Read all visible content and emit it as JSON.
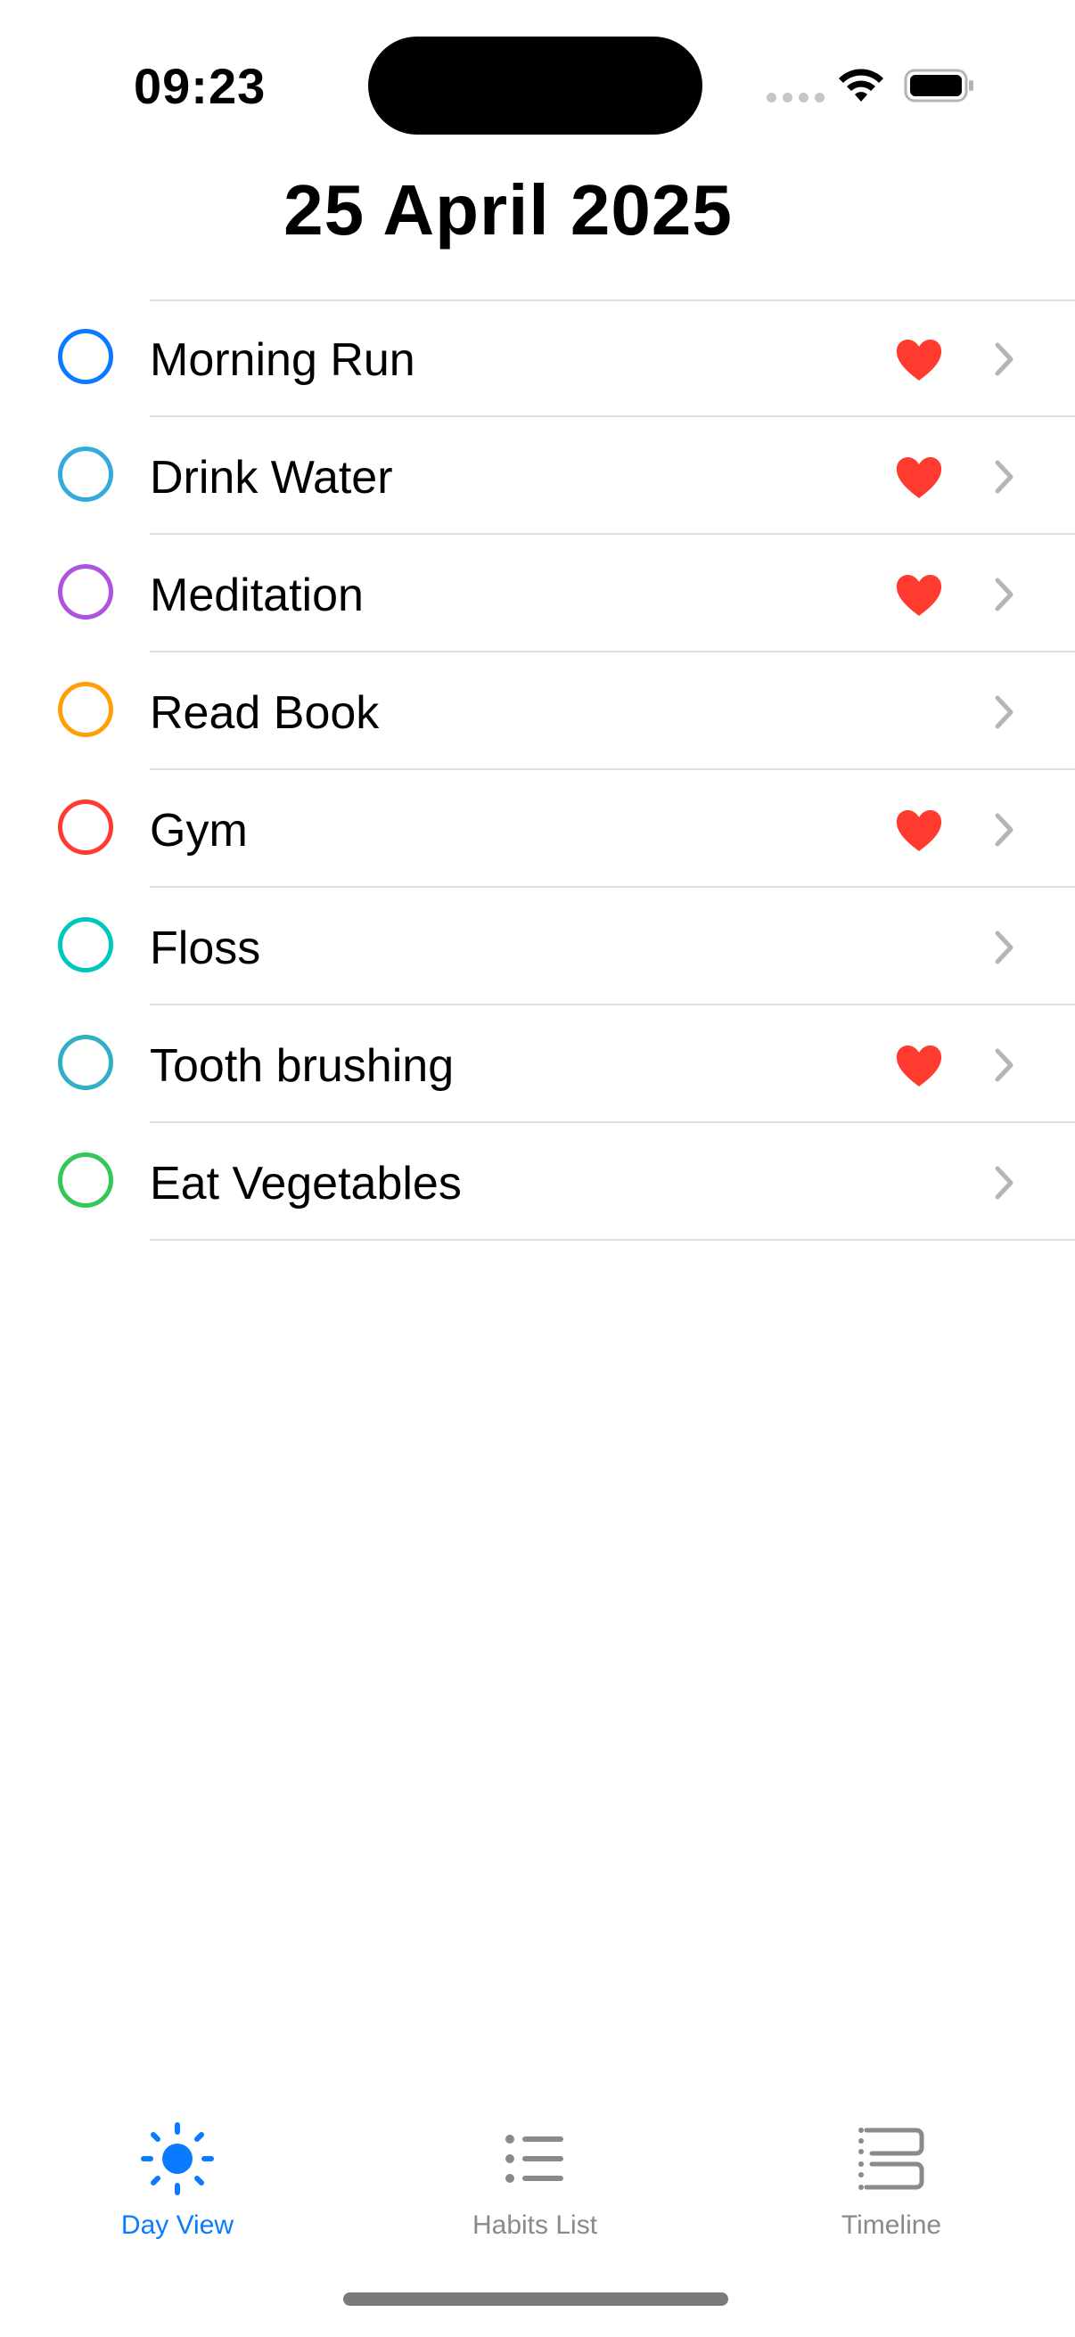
{
  "status_bar": {
    "time": "09:23"
  },
  "header": {
    "title": "25 April 2025"
  },
  "habits": [
    {
      "name": "Morning Run",
      "color": "#0a7aff",
      "favorite": true
    },
    {
      "name": "Drink Water",
      "color": "#34aadc",
      "favorite": true
    },
    {
      "name": "Meditation",
      "color": "#af52de",
      "favorite": true
    },
    {
      "name": "Read Book",
      "color": "#ff9f0a",
      "favorite": false
    },
    {
      "name": "Gym",
      "color": "#ff3b30",
      "favorite": true
    },
    {
      "name": "Floss",
      "color": "#00c7be",
      "favorite": false
    },
    {
      "name": "Tooth brushing",
      "color": "#30b0c7",
      "favorite": true
    },
    {
      "name": "Eat Vegetables",
      "color": "#34c759",
      "favorite": false
    }
  ],
  "tab_bar": {
    "tabs": [
      {
        "label": "Day View",
        "icon": "sun-icon",
        "active": true
      },
      {
        "label": "Habits List",
        "icon": "list-icon",
        "active": false
      },
      {
        "label": "Timeline",
        "icon": "timeline-icon",
        "active": false
      }
    ]
  },
  "colors": {
    "accent": "#0a7aff",
    "heart": "#ff3b30",
    "inactive_tab": "#8a8a8e",
    "separator": "#e0e0e2"
  }
}
